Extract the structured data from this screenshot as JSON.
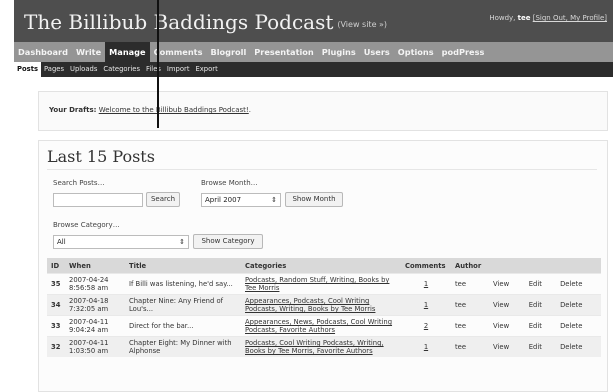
{
  "header": {
    "site_title": "The Billibub Baddings Podcast",
    "view_site": "(View site »)",
    "user_prefix": "Howdy, ",
    "user_name": "tee",
    "user_links": "[Sign Out, My Profile]"
  },
  "main_nav": [
    "Dashboard",
    "Write",
    "Manage",
    "Comments",
    "Blogroll",
    "Presentation",
    "Plugins",
    "Users",
    "Options",
    "podPress"
  ],
  "main_nav_active": "Manage",
  "sub_nav": [
    "Posts",
    "Pages",
    "Uploads",
    "Categories",
    "Files",
    "Import",
    "Export"
  ],
  "sub_nav_active": "Posts",
  "drafts": {
    "label": "Your Drafts:",
    "link": "Welcome to the Billibub Baddings Podcast!",
    "suffix": "."
  },
  "panel": {
    "title": "Last 15 Posts",
    "search_label": "Search Posts…",
    "search_value": "",
    "search_button": "Search",
    "month_label": "Browse Month…",
    "month_value": "April 2007",
    "month_button": "Show Month",
    "category_label": "Browse Category…",
    "category_value": "All",
    "category_button": "Show Category"
  },
  "table": {
    "headers": [
      "ID",
      "When",
      "Title",
      "Categories",
      "Comments",
      "Author",
      "",
      "",
      ""
    ],
    "rows": [
      {
        "id": "35",
        "when": "2007-04-24 8:56:58 am",
        "title": "If Billi was listening, he'd say...",
        "categories": "Podcasts, Random Stuff, Writing, Books by Tee Morris",
        "comments": "1",
        "author": "tee",
        "view": "View",
        "edit": "Edit",
        "delete": "Delete"
      },
      {
        "id": "34",
        "when": "2007-04-18 7:32:05 am",
        "title": "Chapter Nine: Any Friend of Lou's...",
        "categories": "Appearances, Podcasts, Cool Writing Podcasts, Writing, Books by Tee Morris",
        "comments": "1",
        "author": "tee",
        "view": "View",
        "edit": "Edit",
        "delete": "Delete"
      },
      {
        "id": "33",
        "when": "2007-04-11 9:04:24 am",
        "title": "Direct for the bar...",
        "categories": "Appearances, News, Podcasts, Cool Writing Podcasts, Favorite Authors",
        "comments": "2",
        "author": "tee",
        "view": "View",
        "edit": "Edit",
        "delete": "Delete"
      },
      {
        "id": "32",
        "when": "2007-04-11 1:03:50 am",
        "title": "Chapter Eight: My Dinner with Alphonse",
        "categories": "Podcasts, Cool Writing Podcasts, Writing, Books by Tee Morris, Favorite Authors",
        "comments": "1",
        "author": "tee",
        "view": "View",
        "edit": "Edit",
        "delete": "Delete"
      }
    ]
  }
}
